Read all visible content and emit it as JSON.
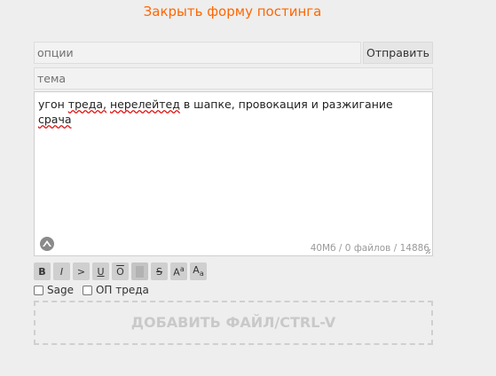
{
  "form": {
    "close_label": "Закрыть форму постинга",
    "options_placeholder": "опции",
    "subject_placeholder": "тема",
    "submit_label": "Отправить",
    "message": {
      "words": [
        "угон",
        "треда,",
        "нерелейтед",
        "в шапке,",
        "провокация и разжигание",
        "срача"
      ],
      "counter": "40Мб / 0 файлов / 14886"
    }
  },
  "markup": [
    {
      "label": "B",
      "icon": "bold-icon"
    },
    {
      "label": "I",
      "icon": "italic-icon"
    },
    {
      "label": ">",
      "icon": "quote-icon"
    },
    {
      "label": "U",
      "icon": "underline-icon"
    },
    {
      "label": "O",
      "icon": "overline-icon"
    },
    {
      "label": "",
      "icon": "spoiler-icon"
    },
    {
      "label": "S",
      "icon": "strikethrough-icon"
    },
    {
      "label": "A",
      "sup": "a",
      "icon": "superscript-icon"
    },
    {
      "label": "A",
      "sub": "a",
      "icon": "subscript-icon"
    }
  ],
  "checkboxes": {
    "sage_label": "Sage",
    "op_label": "ОП треда"
  },
  "dropzone_label": "ДОБАВИТЬ ФАЙЛ/CTRL-V"
}
